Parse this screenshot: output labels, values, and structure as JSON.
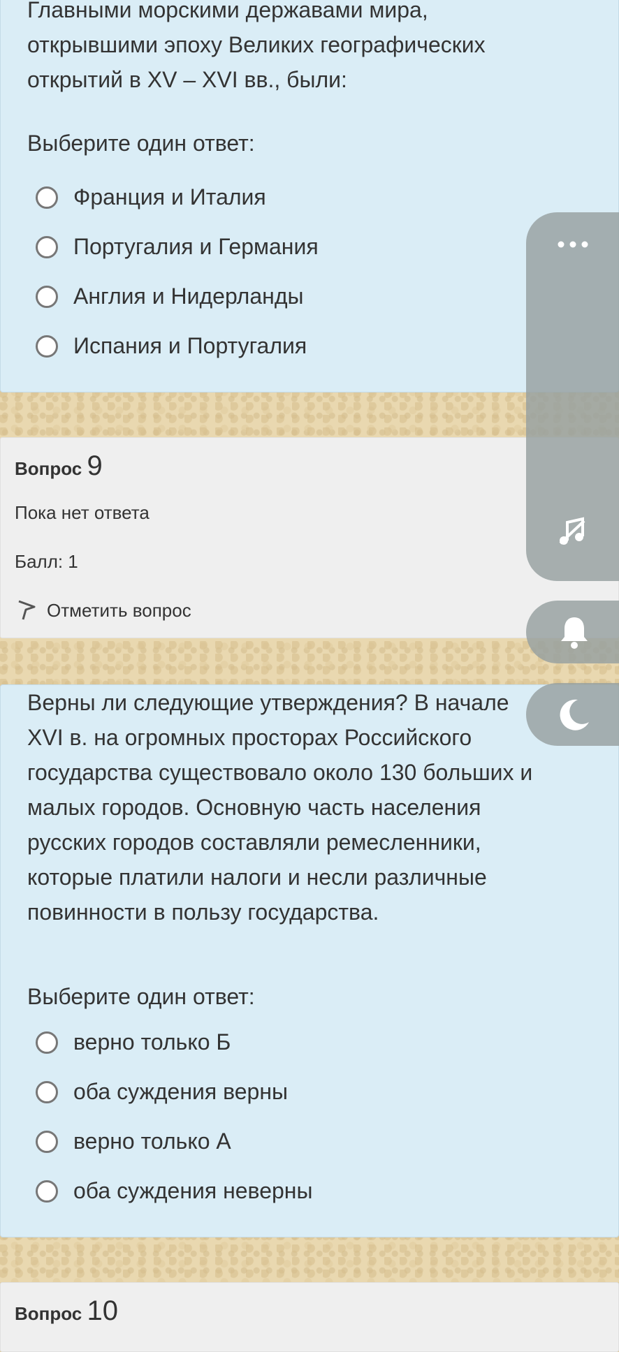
{
  "question8": {
    "text_lines": [
      "Главными морскими державами мира,",
      "открывшими эпоху Великих географических",
      "открытий в XV – XVI вв., были:"
    ],
    "prompt": "Выберите один ответ:",
    "options": [
      "Франция и Италия",
      "Португалия и Германия",
      "Англия и Нидерланды",
      "Испания и Португалия"
    ]
  },
  "question9_info": {
    "label": "Вопрос",
    "number": "9",
    "status": "Пока нет ответа",
    "grade": "Балл: 1",
    "flag_label": "Отметить вопрос"
  },
  "question9": {
    "text_lines": [
      "Верны ли следующие утверждения? В начале",
      "XVI в. на огромных просторах Российского",
      "государства существовало около 130 больших и",
      "малых городов. Основную часть населения",
      "русских городов составляли ремесленники,",
      "которые платили налоги и несли различные",
      "повинности в пользу государства."
    ],
    "prompt": "Выберите один ответ:",
    "options": [
      "верно только Б",
      "оба суждения верны",
      "верно только А",
      "оба суждения неверны"
    ]
  },
  "question10_info": {
    "label": "Вопрос",
    "number": "10"
  },
  "side_controls": {
    "menu_icon": "more-dots-icon",
    "music_icon": "music-off-icon",
    "bell_icon": "bell-icon",
    "night_icon": "moon-icon"
  },
  "colors": {
    "question_bg": "#daedf6",
    "info_bg": "#efefef",
    "page_bg": "#e9d8b0",
    "side_panel": "#96a0a0"
  }
}
